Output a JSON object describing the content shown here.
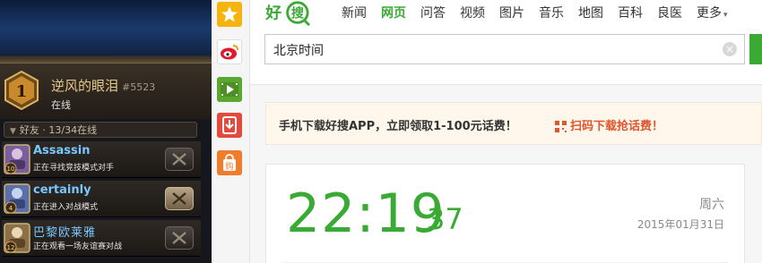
{
  "game_panel": {
    "profile": {
      "rank": "1",
      "name": "逆风的眼泪",
      "tag": "#5523",
      "status": "在线"
    },
    "friends_header": "好友 · 13/34在线",
    "friends": [
      {
        "name": "Assassin",
        "level": "10",
        "activity": "正在寻找竞技模式对手",
        "portrait_color": "#7a5f9c"
      },
      {
        "name": "certainly",
        "level": "4",
        "activity": "正在进入对战模式",
        "portrait_color": "#5b6fa8"
      },
      {
        "name": "巴黎欧莱雅",
        "level": "12",
        "activity": "正在观看一场友谊赛对战",
        "portrait_color": "#8c7048"
      }
    ]
  },
  "icon_bar": [
    {
      "icon": "star-icon",
      "color": "#f6b40e"
    },
    {
      "icon": "weibo-icon",
      "color": "#e6162d"
    },
    {
      "icon": "video-play-icon",
      "color": "#5aa830"
    },
    {
      "icon": "download-icon",
      "color": "#e24a3b"
    },
    {
      "icon": "shopping-bag-icon",
      "color": "#f07c2e"
    }
  ],
  "browser": {
    "logo": {
      "text_a": "好",
      "text_b": "搜"
    },
    "nav": [
      "新闻",
      "网页",
      "问答",
      "视频",
      "图片",
      "音乐",
      "地图",
      "百科",
      "良医",
      "更多"
    ],
    "active_nav": "网页",
    "search": {
      "value": "北京时间",
      "clear_glyph": "×"
    },
    "promo": {
      "text": "手机下载好搜APP，立即领取1-100元话费！",
      "link": "扫码下载抢话费！"
    },
    "time": {
      "hm": "22:19",
      "seconds": "37",
      "weekday": "周六",
      "date": "2015年01月31日"
    },
    "colors": {
      "brand_green": "#3aaa35",
      "promo_orange": "#e0552a"
    }
  }
}
